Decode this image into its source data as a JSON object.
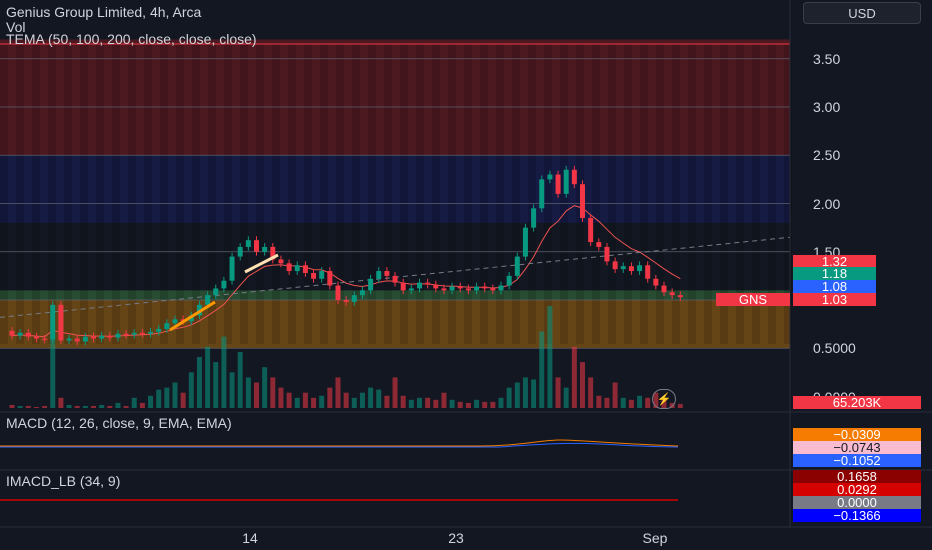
{
  "header": {
    "symbol_line": "Genius Group Limited, 4h, Arca",
    "vol_label": "Vol",
    "tema_label": "TEMA (50, 100, 200, close, close, close)"
  },
  "currency": "USD",
  "price_axis": {
    "labels": [
      "3.50",
      "3.00",
      "2.50",
      "2.00",
      "1.50",
      "1.00",
      "0.5000",
      "0.0000"
    ],
    "tags": [
      {
        "text": "1.32",
        "color": "#f23645"
      },
      {
        "text": "1.18",
        "color": "#089981"
      },
      {
        "text": "1.08",
        "color": "#2962ff"
      },
      {
        "text": "1.03",
        "color": "#f23645"
      }
    ],
    "symbol_tag": "GNS",
    "volume_tag": "65.203K"
  },
  "date_axis": [
    "14",
    "23",
    "Sep"
  ],
  "macd": {
    "label": "MACD (12, 26, close, 9, EMA, EMA)",
    "values": [
      {
        "text": "−0.0309",
        "bg": "#f57c00",
        "fg": "#ffffff"
      },
      {
        "text": "−0.0743",
        "bg": "#f8bbd0",
        "fg": "#131722"
      },
      {
        "text": "−0.1052",
        "bg": "#2962ff",
        "fg": "#ffffff"
      }
    ]
  },
  "imacd": {
    "label": "IMACD_LB (34, 9)",
    "values": [
      {
        "text": "0.1658",
        "bg": "#8b0000",
        "fg": "#ffffff"
      },
      {
        "text": "0.0292",
        "bg": "#d50000",
        "fg": "#ffffff"
      },
      {
        "text": "0.0000",
        "bg": "#787b86",
        "fg": "#ffffff"
      },
      {
        "text": "−0.1366",
        "bg": "#0000ff",
        "fg": "#ffffff"
      }
    ]
  },
  "colors": {
    "up": "#089981",
    "down": "#f23645",
    "background": "#131722"
  },
  "chart_data": {
    "type": "candlestick",
    "price_levels": [
      3.5,
      3.0,
      2.5,
      2.0,
      1.5,
      1.0,
      0.5
    ],
    "zones": [
      {
        "from": 2.5,
        "to": 3.7,
        "color": "#b71c1c"
      },
      {
        "from": 1.8,
        "to": 2.5,
        "color": "#1a237e"
      },
      {
        "from": 1.0,
        "to": 1.1,
        "color": "#4caf50"
      },
      {
        "from": 0.5,
        "to": 1.0,
        "color": "#ff9800"
      }
    ],
    "candles": [
      [
        0.68,
        0.63
      ],
      [
        0.63,
        0.66
      ],
      [
        0.66,
        0.62
      ],
      [
        0.62,
        0.6
      ],
      [
        0.6,
        0.59
      ],
      [
        0.59,
        0.95
      ],
      [
        0.95,
        0.58
      ],
      [
        0.58,
        0.6
      ],
      [
        0.6,
        0.57
      ],
      [
        0.57,
        0.62
      ],
      [
        0.62,
        0.6
      ],
      [
        0.6,
        0.63
      ],
      [
        0.63,
        0.61
      ],
      [
        0.61,
        0.65
      ],
      [
        0.65,
        0.64
      ],
      [
        0.64,
        0.66
      ],
      [
        0.66,
        0.65
      ],
      [
        0.65,
        0.67
      ],
      [
        0.67,
        0.7
      ],
      [
        0.7,
        0.76
      ],
      [
        0.76,
        0.8
      ],
      [
        0.8,
        0.78
      ],
      [
        0.78,
        0.84
      ],
      [
        0.84,
        0.95
      ],
      [
        0.95,
        1.05
      ],
      [
        1.05,
        1.12
      ],
      [
        1.12,
        1.2
      ],
      [
        1.2,
        1.45
      ],
      [
        1.45,
        1.55
      ],
      [
        1.55,
        1.62
      ],
      [
        1.62,
        1.5
      ],
      [
        1.5,
        1.55
      ],
      [
        1.55,
        1.42
      ],
      [
        1.42,
        1.38
      ],
      [
        1.38,
        1.3
      ],
      [
        1.3,
        1.36
      ],
      [
        1.36,
        1.28
      ],
      [
        1.28,
        1.22
      ],
      [
        1.22,
        1.3
      ],
      [
        1.3,
        1.15
      ],
      [
        1.15,
        1.0
      ],
      [
        1.0,
        0.98
      ],
      [
        0.98,
        1.05
      ],
      [
        1.05,
        1.1
      ],
      [
        1.1,
        1.22
      ],
      [
        1.22,
        1.3
      ],
      [
        1.3,
        1.25
      ],
      [
        1.25,
        1.18
      ],
      [
        1.18,
        1.1
      ],
      [
        1.1,
        1.12
      ],
      [
        1.12,
        1.18
      ],
      [
        1.18,
        1.16
      ],
      [
        1.16,
        1.12
      ],
      [
        1.12,
        1.1
      ],
      [
        1.1,
        1.14
      ],
      [
        1.14,
        1.12
      ],
      [
        1.12,
        1.1
      ],
      [
        1.1,
        1.14
      ],
      [
        1.14,
        1.12
      ],
      [
        1.12,
        1.1
      ],
      [
        1.1,
        1.15
      ],
      [
        1.15,
        1.25
      ],
      [
        1.25,
        1.45
      ],
      [
        1.45,
        1.75
      ],
      [
        1.75,
        1.95
      ],
      [
        1.95,
        2.25
      ],
      [
        2.25,
        2.3
      ],
      [
        2.3,
        2.1
      ],
      [
        2.1,
        2.35
      ],
      [
        2.35,
        2.2
      ],
      [
        2.2,
        1.85
      ],
      [
        1.85,
        1.6
      ],
      [
        1.6,
        1.55
      ],
      [
        1.55,
        1.4
      ],
      [
        1.4,
        1.32
      ],
      [
        1.32,
        1.35
      ],
      [
        1.35,
        1.3
      ],
      [
        1.3,
        1.36
      ],
      [
        1.36,
        1.22
      ],
      [
        1.22,
        1.15
      ],
      [
        1.15,
        1.08
      ],
      [
        1.08,
        1.05
      ],
      [
        1.05,
        1.03
      ]
    ],
    "volume": [
      0.03,
      0.02,
      0.02,
      0.01,
      0.02,
      0.82,
      0.1,
      0.03,
      0.02,
      0.02,
      0.02,
      0.03,
      0.02,
      0.05,
      0.02,
      0.1,
      0.05,
      0.12,
      0.18,
      0.2,
      0.25,
      0.15,
      0.35,
      0.5,
      0.6,
      0.45,
      0.7,
      0.35,
      0.55,
      0.3,
      0.25,
      0.4,
      0.3,
      0.2,
      0.15,
      0.1,
      0.15,
      0.1,
      0.12,
      0.2,
      0.3,
      0.15,
      0.1,
      0.15,
      0.2,
      0.18,
      0.12,
      0.3,
      0.12,
      0.08,
      0.1,
      0.1,
      0.08,
      0.15,
      0.08,
      0.06,
      0.05,
      0.08,
      0.06,
      0.06,
      0.1,
      0.2,
      0.25,
      0.3,
      0.28,
      0.75,
      1.0,
      0.3,
      0.2,
      0.6,
      0.45,
      0.3,
      0.12,
      0.1,
      0.25,
      0.1,
      0.08,
      0.12,
      0.1,
      0.15,
      0.1,
      0.05,
      0.04
    ]
  }
}
